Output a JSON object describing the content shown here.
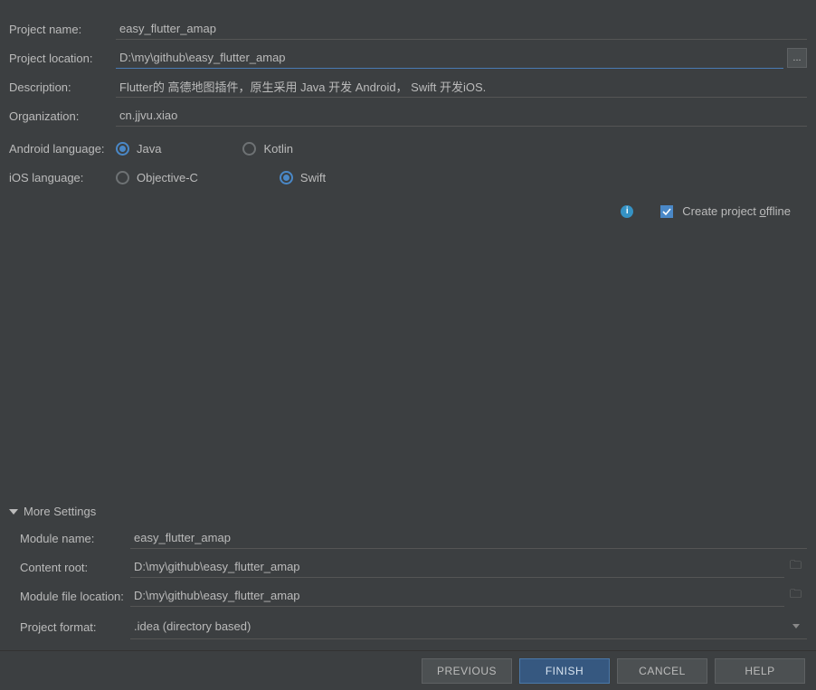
{
  "labels": {
    "project_name": "Project name:",
    "project_location": "Project location:",
    "description": "Description:",
    "organization": "Organization:",
    "android_language": "Android language:",
    "ios_language": "iOS language:",
    "more_settings": "More Settings",
    "module_name": "Module name:",
    "content_root": "Content root:",
    "module_file_location": "Module file location:",
    "project_format": "Project format:"
  },
  "values": {
    "project_name": "easy_flutter_amap",
    "project_location": "D:\\my\\github\\easy_flutter_amap",
    "description": "Flutter的 高德地图插件，原生采用 Java 开发 Android， Swift 开发iOS.",
    "organization": "cn.jjvu.xiao",
    "module_name": "easy_flutter_amap",
    "content_root": "D:\\my\\github\\easy_flutter_amap",
    "module_file_location": "D:\\my\\github\\easy_flutter_amap",
    "project_format": ".idea (directory based)"
  },
  "radios": {
    "android": {
      "java": "Java",
      "kotlin": "Kotlin",
      "selected": "java"
    },
    "ios": {
      "objc": "Objective-C",
      "swift": "Swift",
      "selected": "swift"
    }
  },
  "offline": {
    "label_pre": "Create project ",
    "label_u": "o",
    "label_post": "ffline",
    "checked": true
  },
  "buttons": {
    "previous": "PREVIOUS",
    "finish": "FINISH",
    "cancel": "CANCEL",
    "help": "HELP",
    "browse": "..."
  }
}
